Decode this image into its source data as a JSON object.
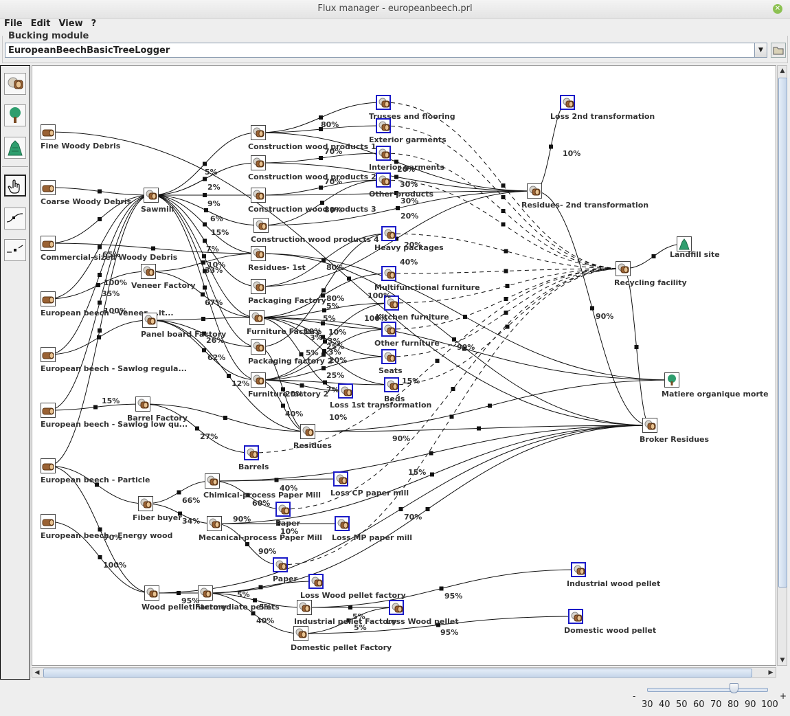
{
  "window": {
    "title": "Flux manager - europeanbeech.prl"
  },
  "menu": [
    "File",
    "Edit",
    "View",
    "?"
  ],
  "bucking": {
    "legend": "Bucking module",
    "selected": "EuropeanBeechBasicTreeLogger"
  },
  "tools": [
    {
      "name": "wood-log-icon",
      "selected": false
    },
    {
      "name": "tree-icon",
      "selected": false
    },
    {
      "name": "landfill-icon",
      "selected": false
    },
    {
      "name": "hand-pointer-icon",
      "selected": true
    },
    {
      "name": "connect-curve-icon",
      "selected": false
    },
    {
      "name": "connect-point-icon",
      "selected": false
    }
  ],
  "nodes": [
    {
      "id": "fwd",
      "label": "Fine Woody Debris",
      "icon": "wood"
    },
    {
      "id": "cwd",
      "label": "Coarse Woody Debris",
      "icon": "wood"
    },
    {
      "id": "csw",
      "label": "Commercial-sized Woody Debris",
      "icon": "wood"
    },
    {
      "id": "ebv",
      "label": "European beech - Veneer ...it...",
      "icon": "wood"
    },
    {
      "id": "ebs",
      "label": "European beech - Sawlog regula...",
      "icon": "wood"
    },
    {
      "id": "ebl",
      "label": "European beech - Sawlog low qu...",
      "icon": "wood"
    },
    {
      "id": "ebp",
      "label": "European beech - Particle",
      "icon": "wood"
    },
    {
      "id": "ebe",
      "label": "European beech - Energy wood",
      "icon": "wood"
    },
    {
      "id": "saw",
      "label": "Sawmill",
      "icon": "proc"
    },
    {
      "id": "ven",
      "label": "Veneer Factory",
      "icon": "proc"
    },
    {
      "id": "pbf",
      "label": "Panel board Factory",
      "icon": "proc"
    },
    {
      "id": "bar",
      "label": "Barrel Factory",
      "icon": "proc"
    },
    {
      "id": "fib",
      "label": "Fiber buyer",
      "icon": "proc"
    },
    {
      "id": "cwp1",
      "label": "Construction wood products 1",
      "icon": "proc"
    },
    {
      "id": "cwp2",
      "label": "Construction wood products 2",
      "icon": "proc"
    },
    {
      "id": "cwp3",
      "label": "Construction wood products 3",
      "icon": "proc"
    },
    {
      "id": "cwp4",
      "label": "Construction wood products 4",
      "icon": "proc"
    },
    {
      "id": "r1",
      "label": "Residues- 1st",
      "icon": "proc"
    },
    {
      "id": "pkf",
      "label": "Packaging Factory",
      "icon": "proc"
    },
    {
      "id": "ff",
      "label": "Furniture Factory",
      "icon": "proc"
    },
    {
      "id": "pkf2",
      "label": "Packaging factory 2",
      "icon": "proc"
    },
    {
      "id": "ff2",
      "label": "Furniture factory 2",
      "icon": "proc"
    },
    {
      "id": "res",
      "label": "Residues",
      "icon": "proc"
    },
    {
      "id": "tru",
      "label": "Trusses and flooring",
      "icon": "term"
    },
    {
      "id": "ext",
      "label": "Exterior garments",
      "icon": "term"
    },
    {
      "id": "int",
      "label": "Interior garments",
      "icon": "term"
    },
    {
      "id": "oth",
      "label": "Other products",
      "icon": "term"
    },
    {
      "id": "hp",
      "label": "Heavy packages",
      "icon": "term"
    },
    {
      "id": "mf",
      "label": "Multifunctional furniture",
      "icon": "term"
    },
    {
      "id": "kf",
      "label": "Kitchen furniture",
      "icon": "term"
    },
    {
      "id": "of",
      "label": "Other furniture",
      "icon": "term"
    },
    {
      "id": "seats",
      "label": "Seats",
      "icon": "term"
    },
    {
      "id": "beds",
      "label": "Beds",
      "icon": "term"
    },
    {
      "id": "l1",
      "label": "Loss 1st transformation",
      "icon": "term"
    },
    {
      "id": "bars",
      "label": "Barrels",
      "icon": "term"
    },
    {
      "id": "l2",
      "label": "Loss 2nd transformation",
      "icon": "term"
    },
    {
      "id": "r2",
      "label": "Residues- 2nd transformation",
      "icon": "proc"
    },
    {
      "id": "rec",
      "label": "Recycling facility",
      "icon": "proc"
    },
    {
      "id": "land",
      "label": "Landfill site",
      "icon": "landfill"
    },
    {
      "id": "mom",
      "label": "Matiere organique morte",
      "icon": "tree"
    },
    {
      "id": "brk",
      "label": "Broker Residues",
      "icon": "proc"
    },
    {
      "id": "cpm",
      "label": "Chimical-process Paper Mill",
      "icon": "proc"
    },
    {
      "id": "lcp",
      "label": "Loss CP paper mill",
      "icon": "term"
    },
    {
      "id": "pap1",
      "label": "Paper",
      "icon": "term"
    },
    {
      "id": "mpm",
      "label": "Mecanical-process Paper Mill",
      "icon": "proc"
    },
    {
      "id": "lmp",
      "label": "Loss MP paper mill",
      "icon": "term"
    },
    {
      "id": "pap2",
      "label": "Paper",
      "icon": "term"
    },
    {
      "id": "wpf",
      "label": "Wood pellet Factory",
      "icon": "proc"
    },
    {
      "id": "ip",
      "label": "Intermediate pellets",
      "icon": "proc"
    },
    {
      "id": "lwpf",
      "label": "Loss Wood pellet factory",
      "icon": "term"
    },
    {
      "id": "ipf",
      "label": "Industrial pellet Factory",
      "icon": "proc"
    },
    {
      "id": "lwp",
      "label": "Loss Wood pellet",
      "icon": "term"
    },
    {
      "id": "dpf",
      "label": "Domestic pellet Factory",
      "icon": "proc"
    },
    {
      "id": "iwp",
      "label": "Industrial wood pellet",
      "icon": "term"
    },
    {
      "id": "dwp",
      "label": "Domestic wood pellet",
      "icon": "term"
    }
  ],
  "percentages": [
    "80%",
    "70%",
    "20%",
    "5%",
    "2%",
    "70%",
    "30%",
    "9%",
    "80%",
    "30%",
    "6%",
    "20%",
    "15%",
    "7%",
    "20%",
    "40%",
    "10%",
    "33%",
    "80%",
    "65%",
    "100%",
    "100%",
    "35%",
    "100%",
    "100%",
    "67%",
    "80%",
    "5%",
    "5%",
    "10%",
    "10%",
    "3%",
    "3%",
    "25%",
    "5%",
    "3%",
    "20%",
    "25%",
    "26%",
    "12%",
    "62%",
    "7%",
    "20%",
    "40%",
    "10%",
    "15%",
    "90%",
    "15%",
    "27%",
    "10%",
    "90%",
    "90%",
    "15%",
    "40%",
    "66%",
    "60%",
    "34%",
    "90%",
    "10%",
    "70%",
    "70%",
    "100%",
    "90%",
    "95%",
    "5%",
    "5%",
    "5%",
    "5%",
    "40%",
    "95%",
    "95%"
  ],
  "zoom": {
    "minus": "-",
    "plus": "+",
    "ticks": [
      "30",
      "40",
      "50",
      "60",
      "70",
      "80",
      "90",
      "100"
    ],
    "value": 80
  }
}
